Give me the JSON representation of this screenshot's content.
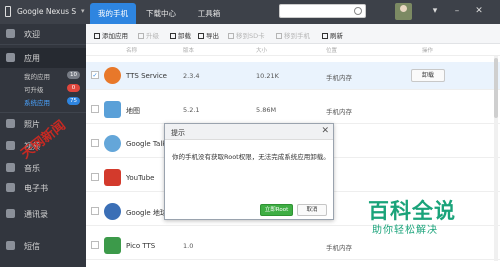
{
  "topbar": {
    "device_name": "Google Nexus S",
    "tabs": [
      {
        "label": "我的手机",
        "active": true
      },
      {
        "label": "下载中心",
        "active": false
      },
      {
        "label": "工具箱",
        "active": false
      }
    ],
    "search_placeholder": "",
    "window_buttons": [
      "▾",
      "–",
      "✕"
    ]
  },
  "sidebar": {
    "items": [
      {
        "label": "欢迎",
        "icon": "home-icon"
      },
      {
        "label": "应用",
        "icon": "apps-icon"
      },
      {
        "label": "照片",
        "icon": "photo-icon"
      },
      {
        "label": "视频",
        "icon": "video-icon"
      },
      {
        "label": "音乐",
        "icon": "music-icon"
      },
      {
        "label": "电子书",
        "icon": "book-icon"
      },
      {
        "label": "通讯录",
        "icon": "contacts-icon"
      },
      {
        "label": "短信",
        "icon": "sms-icon"
      }
    ],
    "sub_items": [
      {
        "label": "我的应用",
        "badge": "10",
        "badge_color": "#777c85"
      },
      {
        "label": "可升级",
        "badge": "0",
        "badge_color": "#e0463c"
      },
      {
        "label": "系统应用",
        "badge": "75",
        "badge_color": "#2e85e0"
      }
    ]
  },
  "toolbar": {
    "buttons": [
      {
        "label": "添加应用",
        "enabled": true
      },
      {
        "label": "升级",
        "enabled": false
      },
      {
        "label": "卸载",
        "enabled": true
      },
      {
        "label": "导出",
        "enabled": true
      },
      {
        "label": "移到SD卡",
        "enabled": false
      },
      {
        "label": "移到手机",
        "enabled": false
      },
      {
        "label": "刷新",
        "enabled": true
      }
    ]
  },
  "table": {
    "headers": [
      "名称",
      "版本",
      "大小",
      "位置",
      "操作"
    ],
    "rows": [
      {
        "name": "TTS Service",
        "version": "2.3.4",
        "size": "10.21K",
        "location": "手机内存",
        "action": "卸载",
        "checked": true,
        "icon_color": "#e8782a"
      },
      {
        "name": "地图",
        "version": "5.2.1",
        "size": "5.86M",
        "location": "手机内存",
        "action": "",
        "checked": false,
        "icon_color": "#5aa0d8"
      },
      {
        "name": "Google Talk",
        "version": "",
        "size": "",
        "location": "",
        "action": "",
        "checked": false,
        "icon_color": "#64a6d9"
      },
      {
        "name": "YouTube",
        "version": "",
        "size": "",
        "location": "",
        "action": "",
        "checked": false,
        "icon_color": "#d33a2c"
      },
      {
        "name": "Google 地球",
        "version": "",
        "size": "",
        "location": "",
        "action": "",
        "checked": false,
        "icon_color": "#3b6fb6"
      },
      {
        "name": "Pico TTS",
        "version": "1.0",
        "size": "",
        "location": "手机内存",
        "action": "",
        "checked": false,
        "icon_color": "#3c9a4a"
      }
    ]
  },
  "dialog": {
    "title": "提示",
    "close": "✕",
    "message": "你的手机没有获取Root权限，无法完成系统应用卸载。",
    "ok_label": "立即Root",
    "cancel_label": "取消"
  },
  "watermark": {
    "left_text": "天网新闻",
    "logo": "百科全说",
    "tagline": "助你轻松解决"
  }
}
